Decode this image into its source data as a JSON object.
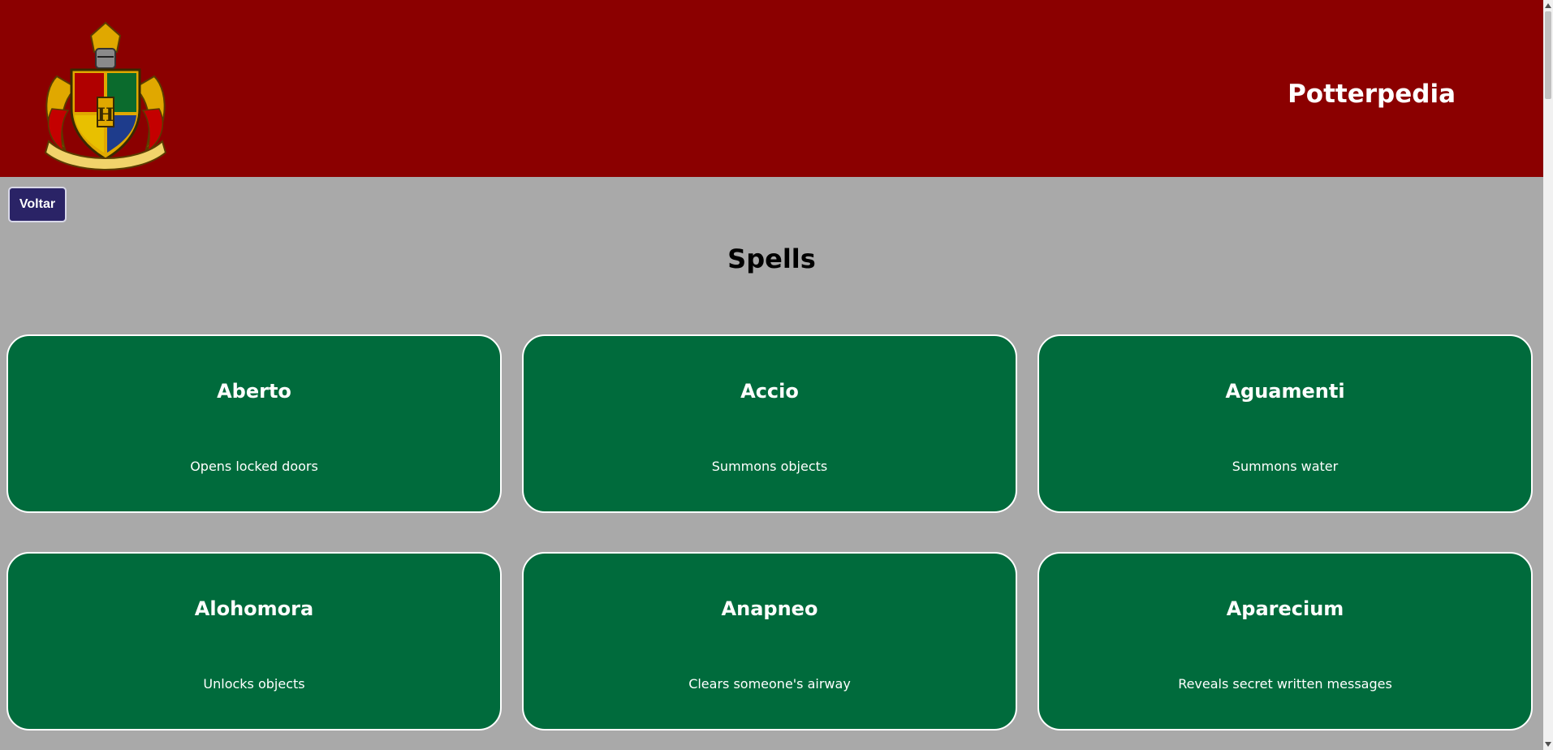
{
  "header": {
    "site_title": "Potterpedia",
    "crest_icon": "hogwarts-crest-icon",
    "background": "#8b0000"
  },
  "nav": {
    "back_label": "Voltar"
  },
  "main": {
    "title": "Spells"
  },
  "spells": [
    {
      "name": "Aberto",
      "description": "Opens locked doors"
    },
    {
      "name": "Accio",
      "description": "Summons objects"
    },
    {
      "name": "Aguamenti",
      "description": "Summons water"
    },
    {
      "name": "Alohomora",
      "description": "Unlocks objects"
    },
    {
      "name": "Anapneo",
      "description": "Clears someone's airway"
    },
    {
      "name": "Aparecium",
      "description": "Reveals secret written messages"
    }
  ],
  "colors": {
    "header": "#8b0000",
    "page_background": "#a9a9a9",
    "card": "#006b3c",
    "button": "#2a2366"
  }
}
